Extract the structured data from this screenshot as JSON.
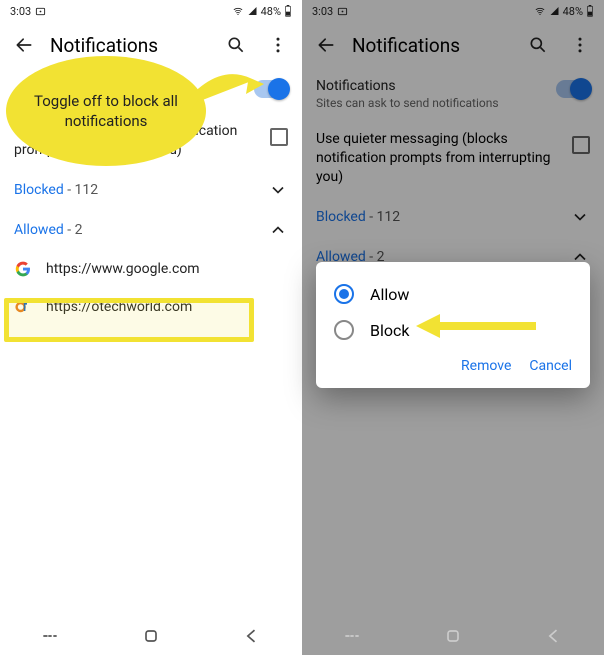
{
  "status": {
    "time": "3:03",
    "battery": "48%"
  },
  "header": {
    "title": "Notifications"
  },
  "notifRow": {
    "title": "Notifications",
    "sub": "Sites can ask to send notifications"
  },
  "quietRow": {
    "line": "Use quieter messaging (blocks notification prompts from interrupting you)",
    "line_left_partial": "Us",
    "line_right_partial1": "notification",
    "line_right_partial2": "prompts",
    "line_right_partial3": "g you)"
  },
  "blocked": {
    "label": "Blocked",
    "count": "- 112"
  },
  "allowed": {
    "label": "Allowed",
    "count": "- 2"
  },
  "sites": [
    {
      "url": "https://www.google.com",
      "icon": "google"
    },
    {
      "url": "https://otechworld.com",
      "icon": "otech"
    }
  ],
  "callout": {
    "text": "Toggle off to block all notifications"
  },
  "dialog": {
    "allow": "Allow",
    "block": "Block",
    "remove": "Remove",
    "cancel": "Cancel"
  }
}
